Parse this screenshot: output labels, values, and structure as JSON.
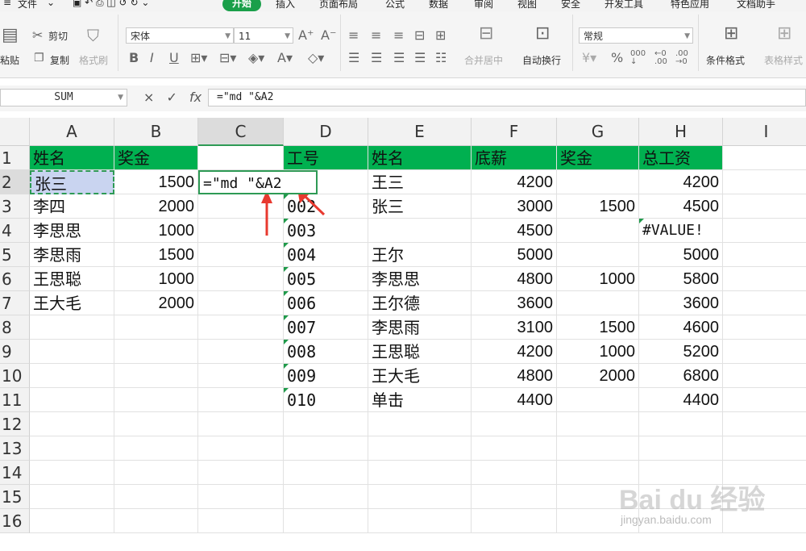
{
  "menu": {
    "file": "文件",
    "tabs": [
      "开始",
      "插入",
      "页面布局",
      "公式",
      "数据",
      "审阅",
      "视图",
      "安全",
      "开发工具",
      "特色应用",
      "文档助手"
    ]
  },
  "ribbon": {
    "cut": "剪切",
    "paste": "粘贴",
    "copy": "复制",
    "format_painter": "格式刷",
    "font_name": "宋体",
    "font_size": "11",
    "merge_center": "合并居中",
    "wrap_text": "自动换行",
    "number_format": "常规",
    "conditional_format": "条件格式",
    "table_style": "表格样式"
  },
  "formula_bar": {
    "name_box": "SUM",
    "cancel_icon": "×",
    "enter_icon": "✓",
    "fx_label": "fx",
    "formula": "=\"md \"&A2"
  },
  "columns": [
    "A",
    "B",
    "C",
    "D",
    "E",
    "F",
    "G",
    "H",
    "I"
  ],
  "rows": [
    "1",
    "2",
    "3",
    "4",
    "5",
    "6",
    "7",
    "8",
    "9",
    "10",
    "11",
    "12",
    "13",
    "14",
    "15",
    "16"
  ],
  "sheet": {
    "left_headers": [
      "姓名",
      "奖金"
    ],
    "left_rows": [
      [
        "张三",
        "1500"
      ],
      [
        "李四",
        "2000"
      ],
      [
        "李思思",
        "1000"
      ],
      [
        "李思雨",
        "1500"
      ],
      [
        "王思聪",
        "1000"
      ],
      [
        "王大毛",
        "2000"
      ]
    ],
    "editing_cell": "=\"md \"&A2",
    "right_headers": [
      "工号",
      "姓名",
      "底薪",
      "奖金",
      "总工资"
    ],
    "right_rows": [
      [
        "",
        "王三",
        "4200",
        "",
        "4200"
      ],
      [
        "002",
        "张三",
        "3000",
        "1500",
        "4500"
      ],
      [
        "003",
        "",
        "4500",
        "",
        "#VALUE!"
      ],
      [
        "004",
        "王尔",
        "5000",
        "",
        "5000"
      ],
      [
        "005",
        "李思思",
        "4800",
        "1000",
        "5800"
      ],
      [
        "006",
        "王尔德",
        "3600",
        "",
        "3600"
      ],
      [
        "007",
        "李思雨",
        "3100",
        "1500",
        "4600"
      ],
      [
        "008",
        "王思聪",
        "4200",
        "1000",
        "5200"
      ],
      [
        "009",
        "王大毛",
        "4800",
        "2000",
        "6800"
      ],
      [
        "010",
        "单击",
        "4400",
        "",
        "4400"
      ]
    ]
  },
  "colors": {
    "header_fill": "#00b050",
    "accent": "#1a9f4a",
    "arrow": "#e8392f"
  },
  "watermark": {
    "brand": "Bai du 经验",
    "url": "jingyan.baidu.com"
  }
}
